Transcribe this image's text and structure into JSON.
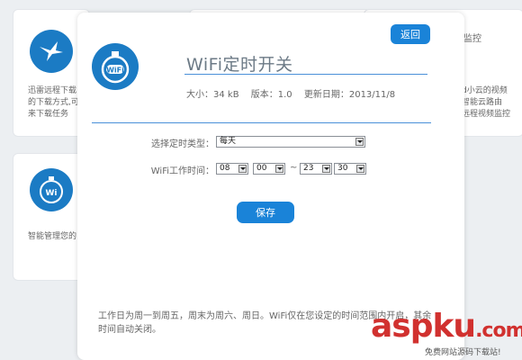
{
  "background": {
    "card1_text": [
      "迅雷远程下载",
      "的下载方式,可",
      "来下载任务"
    ],
    "card2_text": [
      "智能管理您的"
    ],
    "card3_title": "监控",
    "card3_text": [
      "d小云的视频",
      "智能云路由",
      "远程视频监控"
    ]
  },
  "modal": {
    "back_label": "返回",
    "app_title": "WiFi定时开关",
    "size": "大小：34 kB",
    "version": "版本：1.0",
    "updated": "更新日期：2013/11/8",
    "type_label": "选择定时类型：",
    "type_value": "每天",
    "time_label": "WiFi工作时间：",
    "start_hour": "08",
    "start_min": "00",
    "tilde": "~",
    "end_hour": "23",
    "end_min": "30",
    "save_label": "保存",
    "note": "工作日为周一到周五，周末为周六、周日。WiFi仅在您设定的时间范围内开启，其余时间自动关闭。"
  },
  "watermark": {
    "big": "aspku",
    "tld": ".com",
    "small": "免费网站源码下载站!"
  },
  "colors": {
    "accent": "#1a83d8",
    "icon_bg": "#1b7bc4",
    "watermark": "#d1312f"
  }
}
